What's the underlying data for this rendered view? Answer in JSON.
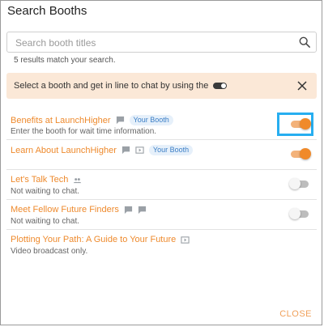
{
  "dialog": {
    "title": "Search Booths",
    "close_label": "CLOSE"
  },
  "search": {
    "placeholder": "Search booth titles",
    "value": "",
    "icon": "search-icon"
  },
  "results_text": "5 results match your search.",
  "banner": {
    "text": "Select a booth and get in line to chat by using the",
    "close_icon": "close-icon"
  },
  "booths": [
    {
      "title": "Benefits at LaunchHigher",
      "subtitle": "Enter the booth for wait time information.",
      "icons": [
        "chat-icon"
      ],
      "badge": "Your Booth",
      "toggle": "on"
    },
    {
      "title": "Learn About LaunchHigher",
      "subtitle": "",
      "icons": [
        "chat-icon",
        "video-icon"
      ],
      "badge": "Your Booth",
      "toggle": "on"
    },
    {
      "title": "Let's Talk Tech",
      "subtitle": "Not waiting to chat.",
      "icons": [
        "group-icon"
      ],
      "badge": "",
      "toggle": "off"
    },
    {
      "title": "Meet Fellow Future Finders",
      "subtitle": "Not waiting to chat.",
      "icons": [
        "chat-icon",
        "chat-icon"
      ],
      "badge": "",
      "toggle": "off"
    },
    {
      "title": "Plotting Your Path: A Guide to Your Future",
      "subtitle": "Video broadcast only.",
      "icons": [
        "video-icon"
      ],
      "badge": "",
      "toggle": ""
    }
  ],
  "colors": {
    "accent": "#ee8a2d",
    "banner_bg": "#fbe8d7",
    "badge_text": "#3b7ec6",
    "highlight": "#27aef0"
  }
}
